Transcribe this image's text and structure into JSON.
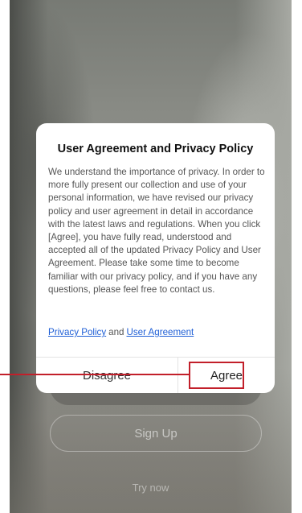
{
  "background": {
    "login_label": "",
    "signup_label": "Sign Up",
    "try_now_label": "Try now"
  },
  "dialog": {
    "title": "User Agreement and Privacy Policy",
    "body": "We understand the importance of privacy. In order to more fully present our collection and use of your personal information, we have revised our privacy policy and user agreement in detail in accordance with the latest laws and regulations. When you click [Agree], you have fully read, understood and accepted all of the updated Privacy Policy and User Agreement. Please take some time to become familiar with our privacy policy, and if you have any questions, please feel free to contact us.",
    "privacy_link": "Privacy Policy",
    "and_text": "and",
    "agreement_link": "User Agreement",
    "disagree_label": "Disagree",
    "agree_label": "Agree"
  },
  "colors": {
    "accent_link": "#1f5fd6",
    "annotation_red": "#c21f2a"
  }
}
